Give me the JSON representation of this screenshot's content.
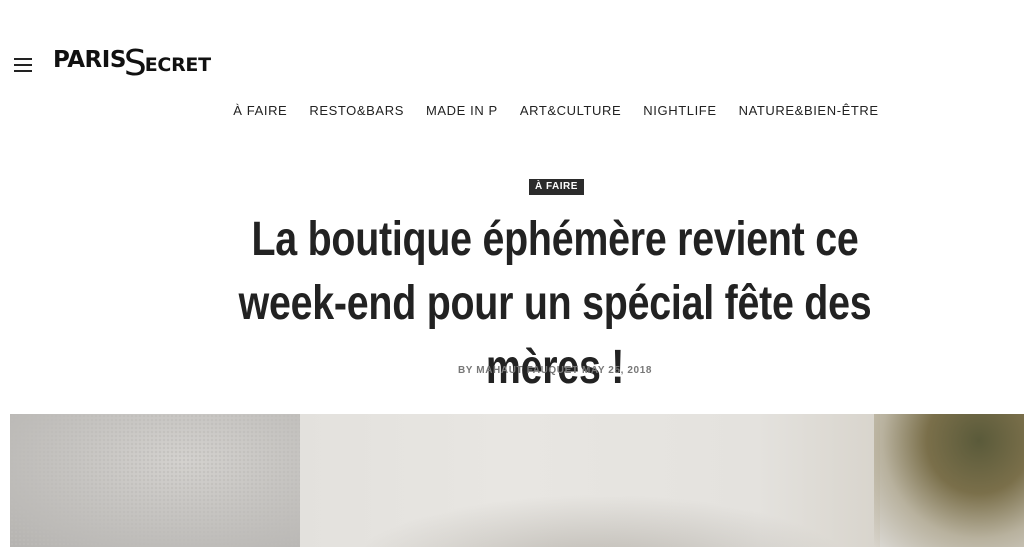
{
  "header": {
    "menu_icon": "hamburger-menu-icon",
    "logo": {
      "part1": "PARIS",
      "part2": "S",
      "part3": "ECRET"
    },
    "nav": [
      {
        "label": "À FAIRE"
      },
      {
        "label": "RESTO&BARS"
      },
      {
        "label": "MADE IN P"
      },
      {
        "label": "ART&CULTURE"
      },
      {
        "label": "NIGHTLIFE"
      },
      {
        "label": "NATURE&BIEN-ÊTRE"
      }
    ]
  },
  "article": {
    "category": "À FAIRE",
    "title": "La boutique éphémère revient ce week-end pour un spécial fête des mères !",
    "byline_prefix": "BY",
    "author": "MAHAUT FAUQUET",
    "date": "MAY 25, 2018"
  },
  "colors": {
    "text": "#222222",
    "badge_bg": "#2b2b2b",
    "byline": "#777777",
    "background": "#ffffff"
  }
}
